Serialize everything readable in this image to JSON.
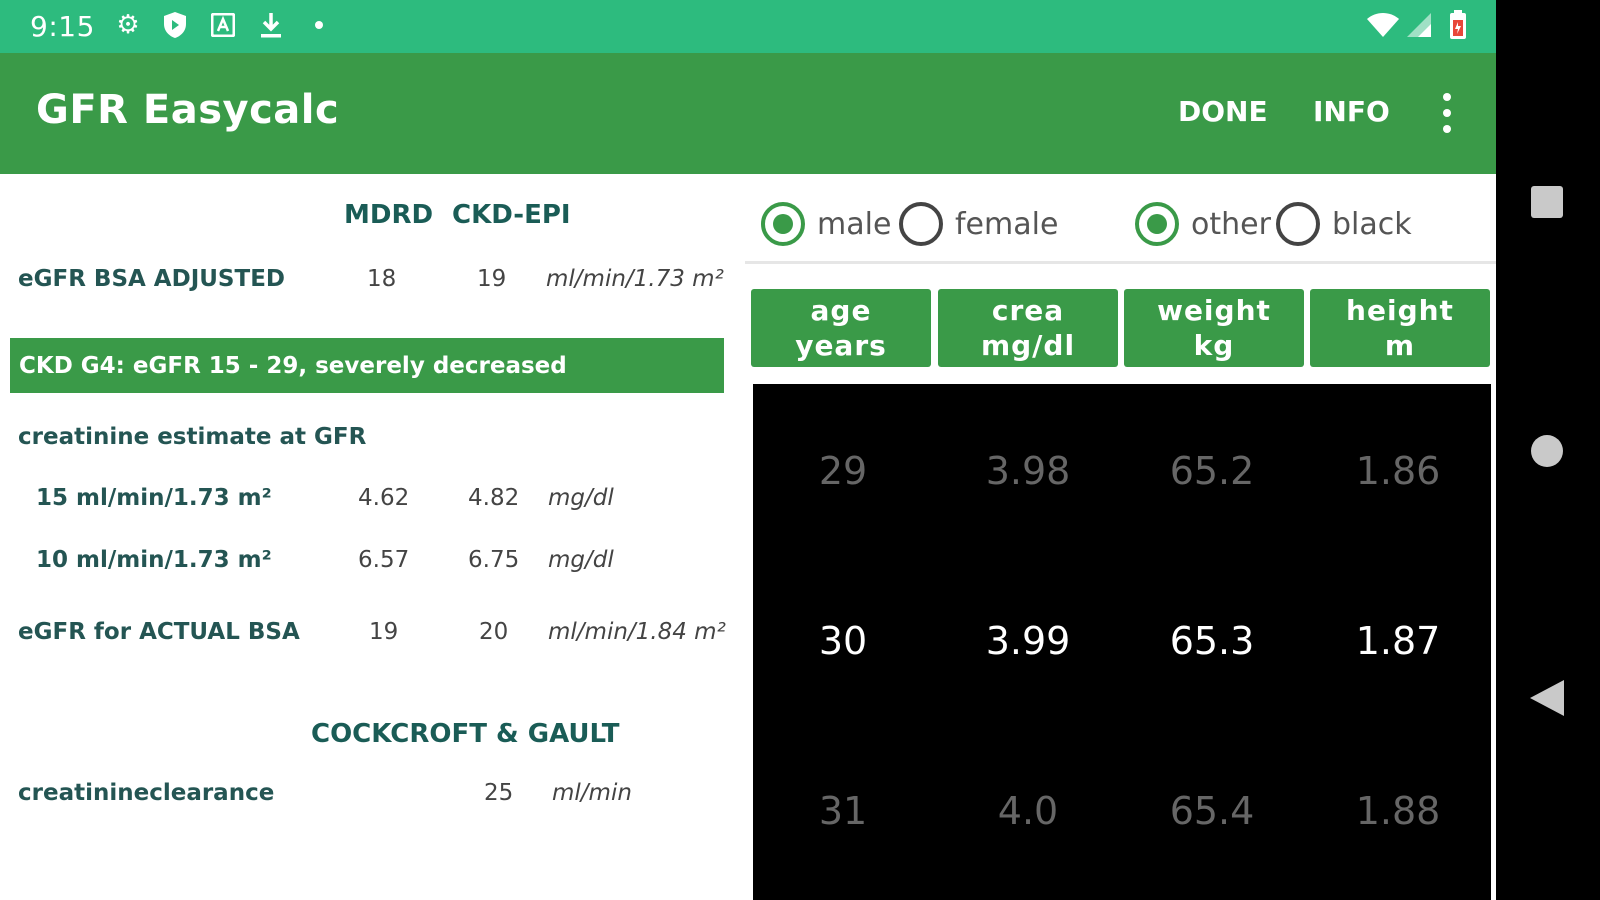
{
  "status_bar": {
    "time": "9:15",
    "icons": [
      "settings-icon",
      "shield-icon",
      "a-box-icon",
      "download-icon",
      "dot-icon",
      "wifi-icon",
      "signal-icon",
      "battery-icon"
    ]
  },
  "app_bar": {
    "title": "GFR Easycalc",
    "done_label": "DONE",
    "info_label": "INFO",
    "overflow_icon": "more-vert-icon",
    "color": "#3a9a48"
  },
  "results": {
    "col_mdrd": "MDRD",
    "col_ckd_epi": "CKD-EPI",
    "egfr_bsa": {
      "label": "eGFR BSA ADJUSTED",
      "mdrd": "18",
      "ckd": "19",
      "unit": "ml/min/1.73 m²"
    },
    "stage_banner": "CKD G4: eGFR 15 - 29, severely decreased",
    "creat_estimate_label": "creatinine estimate at GFR",
    "est_15": {
      "label": "15 ml/min/1.73 m²",
      "mdrd": "4.62",
      "ckd": "4.82",
      "unit": "mg/dl"
    },
    "est_10": {
      "label": "10 ml/min/1.73 m²",
      "mdrd": "6.57",
      "ckd": "6.75",
      "unit": "mg/dl"
    },
    "egfr_actual": {
      "label": "eGFR for ACTUAL BSA",
      "mdrd": "19",
      "ckd": "20",
      "unit": "ml/min/1.84 m²"
    },
    "cg_title": "COCKCROFT & GAULT",
    "cg": {
      "label": "creatinineclearance",
      "value": "25",
      "unit": "ml/min"
    }
  },
  "inputs": {
    "sex": {
      "male": "male",
      "female": "female",
      "selected": "male"
    },
    "race": {
      "other": "other",
      "black": "black",
      "selected": "other"
    },
    "columns": {
      "age": [
        "age",
        "years"
      ],
      "crea": [
        "crea",
        "mg/dl"
      ],
      "weight": [
        "weight",
        "kg"
      ],
      "height": [
        "height",
        "m"
      ]
    },
    "picker": {
      "age": [
        "29",
        "30",
        "31"
      ],
      "crea": [
        "3.98",
        "3.99",
        "4.0"
      ],
      "weight": [
        "65.2",
        "65.3",
        "65.4"
      ],
      "height": [
        "1.86",
        "1.87",
        "1.88"
      ]
    }
  },
  "nav_bar": {
    "icons": [
      "recents-icon",
      "home-icon",
      "back-icon"
    ]
  }
}
